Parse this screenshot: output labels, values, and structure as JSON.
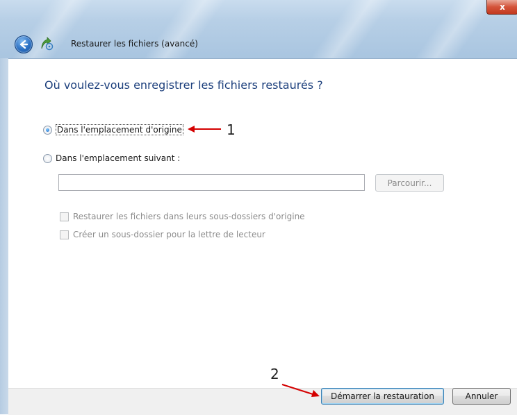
{
  "window": {
    "title": "Restaurer les fichiers (avancé)",
    "close_label": "x"
  },
  "heading": "Où voulez-vous enregistrer les fichiers restaurés ?",
  "options": {
    "original_location": {
      "label": "Dans l'emplacement d'origine",
      "checked": true
    },
    "following_location": {
      "label": "Dans l'emplacement suivant :",
      "checked": false
    }
  },
  "location_input": {
    "value": "",
    "placeholder": ""
  },
  "browse_button": {
    "label": "Parcourir...",
    "enabled": false
  },
  "checkboxes": [
    {
      "label": "Restaurer les fichiers dans leurs sous-dossiers d'origine",
      "checked": false,
      "enabled": false
    },
    {
      "label": "Créer un sous-dossier pour la lettre de lecteur",
      "checked": false,
      "enabled": false
    }
  ],
  "annotations": {
    "one": "1",
    "two": "2",
    "color": "#d40000"
  },
  "buttons": {
    "start_restore": "Démarrer la restauration",
    "cancel": "Annuler"
  },
  "icons": {
    "back": "back-arrow-icon",
    "app": "restore-files-icon",
    "close": "close-icon"
  }
}
